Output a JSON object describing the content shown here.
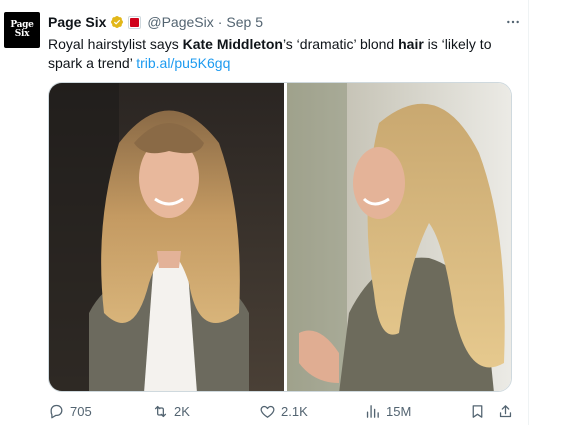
{
  "author": {
    "avatar_line1": "Page",
    "avatar_line2": "Six",
    "display_name": "Page Six",
    "handle": "@PageSix",
    "separator": "·",
    "time": "Sep 5"
  },
  "tweet": {
    "text_1": "Royal hairstylist says ",
    "bold_1": "Kate Middleton",
    "text_2": "’s ‘dramatic’ blond ",
    "bold_2": "hair",
    "text_3": " is ‘likely to spark a trend’ ",
    "link": "trib.al/pu5K6gq"
  },
  "media": {
    "image_count": 2
  },
  "actions": {
    "replies": "705",
    "reposts": "2K",
    "likes": "2.1K",
    "views": "15M"
  },
  "icons": {
    "verified": "verified-gold-icon",
    "affiliate": "affiliate-badge-icon",
    "more": "more-icon",
    "reply": "reply-icon",
    "repost": "repost-icon",
    "like": "like-icon",
    "views": "views-icon",
    "bookmark": "bookmark-icon",
    "share": "share-icon"
  },
  "colors": {
    "text": "#0f1419",
    "secondary": "#536471",
    "link": "#1d9bf0",
    "verified_gold": "#e2b719",
    "affiliate_red": "#d0021b"
  }
}
